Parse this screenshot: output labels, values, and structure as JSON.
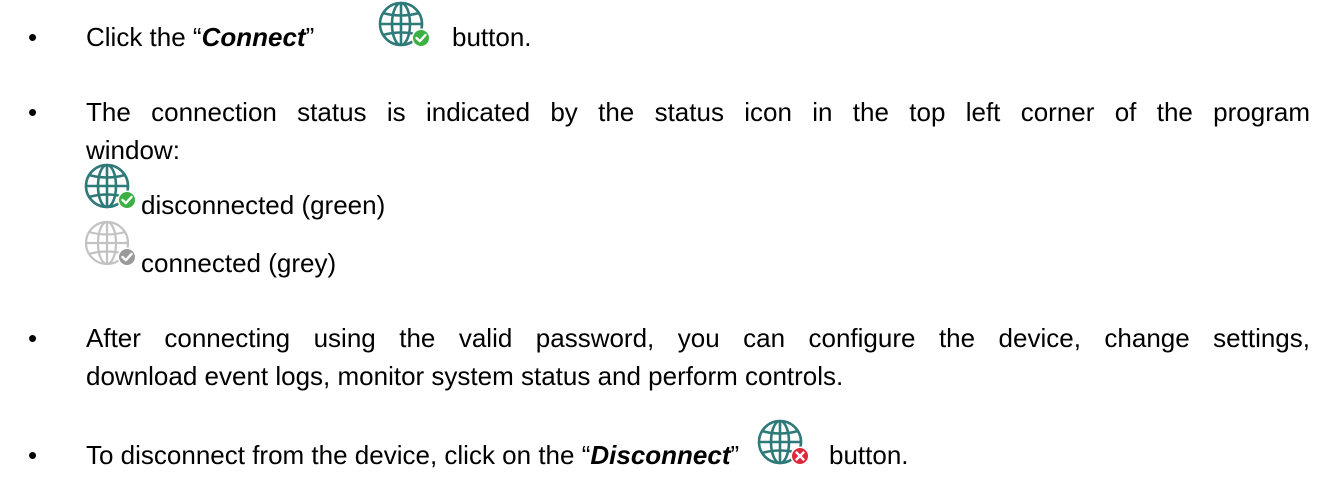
{
  "bullet_char": "•",
  "item1": {
    "before": "Click the “",
    "command": "Connect",
    "quote_close": "”",
    "after": "button.",
    "icon": "globe-green-check-icon"
  },
  "item2": {
    "line1": "The connection status is indicated by the status icon in the top left corner of the program",
    "line2": "window:",
    "status_green": {
      "icon": "globe-green-check-icon",
      "label": "disconnected (green)"
    },
    "status_grey": {
      "icon": "globe-grey-check-icon",
      "label": "connected (grey)"
    }
  },
  "item3": {
    "line1": "After connecting using the valid password, you can configure the device, change settings,",
    "line2": "download event logs, monitor system status and perform controls."
  },
  "item4": {
    "before": "To disconnect from the device, click on the “",
    "command": "Disconnect",
    "quote_close": "”",
    "after": "button.",
    "icon": "globe-red-x-icon"
  },
  "colors": {
    "globe_teal": "#2e7a78",
    "check_green": "#3cb043",
    "grey_globe": "#b9b9b9",
    "grey_badge": "#9a9a9a",
    "x_red": "#e0283c"
  }
}
